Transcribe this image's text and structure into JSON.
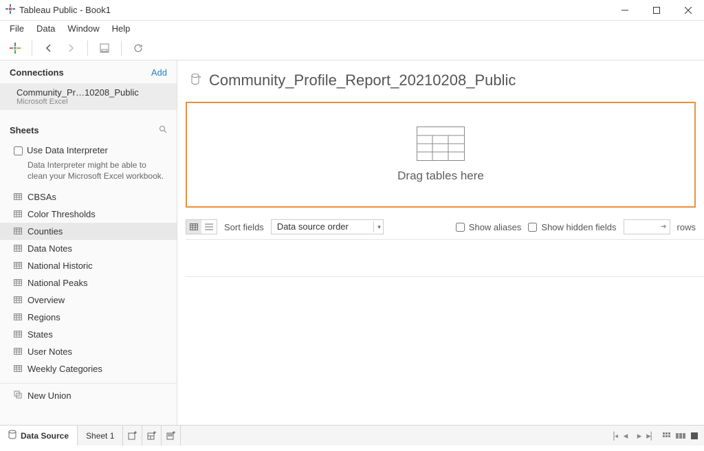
{
  "window": {
    "title": "Tableau Public - Book1"
  },
  "menu": {
    "file": "File",
    "data": "Data",
    "window": "Window",
    "help": "Help"
  },
  "connections": {
    "header": "Connections",
    "add": "Add",
    "items": [
      {
        "name": "Community_Pr…10208_Public",
        "type": "Microsoft Excel"
      }
    ]
  },
  "sheets": {
    "header": "Sheets",
    "interpreter_label": "Use Data Interpreter",
    "interpreter_note": "Data Interpreter might be able to clean your Microsoft Excel workbook.",
    "items": [
      {
        "label": "CBSAs"
      },
      {
        "label": "Color Thresholds"
      },
      {
        "label": "Counties"
      },
      {
        "label": "Data Notes"
      },
      {
        "label": "National Historic"
      },
      {
        "label": "National Peaks"
      },
      {
        "label": "Overview"
      },
      {
        "label": "Regions"
      },
      {
        "label": "States"
      },
      {
        "label": "User Notes"
      },
      {
        "label": "Weekly Categories"
      }
    ],
    "new_union": "New Union"
  },
  "datasource": {
    "title": "Community_Profile_Report_20210208_Public",
    "drag_hint": "Drag tables here",
    "sort_label": "Sort fields",
    "sort_value": "Data source order",
    "show_aliases": "Show aliases",
    "show_hidden": "Show hidden fields",
    "rows_value": "",
    "rows_label": "rows"
  },
  "bottom": {
    "data_source": "Data Source",
    "sheet1": "Sheet 1"
  }
}
